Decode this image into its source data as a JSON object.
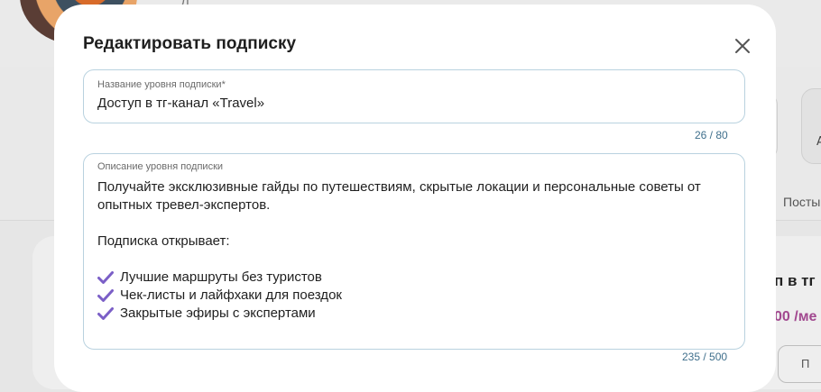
{
  "background": {
    "title_fragment": "Д … …",
    "card_letter": "А",
    "tab_posts": "Посты",
    "tier_title_fragment": "п в тг",
    "tier_price_fragment": "00 /ме",
    "tier_button_fragment": "П"
  },
  "modal": {
    "title": "Редактировать подписку",
    "name_field": {
      "label": "Название уровня подписки*",
      "value": "Доступ в тг-канал «Travel»",
      "counter": "26 / 80"
    },
    "description_field": {
      "label": "Описание уровня подписки",
      "paragraph1": "Получайте эксклюзивные гайды по путешествиям, скрытые локации и персональные советы от опытных тревел-экспертов.",
      "paragraph2": "Подписка открывает:",
      "items": [
        "Лучшие маршруты без туристов",
        "Чек-листы и лайфхаки для поездок",
        "Закрытые эфиры с экспертами"
      ],
      "counter": "235 / 500"
    }
  },
  "colors": {
    "field_border": "#b9d2df",
    "counter_text": "#3f6f8c",
    "check_icon": "#7b5fc7",
    "price_accent": "#a1488f"
  }
}
